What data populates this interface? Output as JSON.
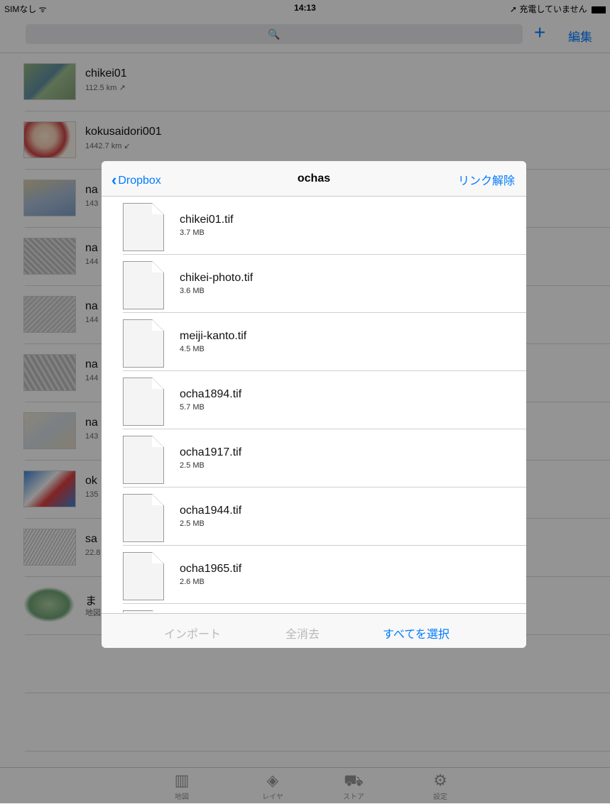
{
  "status_bar": {
    "carrier": "SIMなし ᯤ",
    "time": "14:13",
    "charging": "➚ 充電していません"
  },
  "top_bar": {
    "search_placeholder": "🔍",
    "add_label": "+",
    "edit_label": "編集"
  },
  "maps": [
    {
      "name": "chikei01",
      "sub": "112.5 km ↗"
    },
    {
      "name": "kokusaidori001",
      "sub": "1442.7 km ↙"
    },
    {
      "name": "na",
      "sub": "143"
    },
    {
      "name": "na",
      "sub": "144"
    },
    {
      "name": "na",
      "sub": "144"
    },
    {
      "name": "na",
      "sub": "144"
    },
    {
      "name": "na",
      "sub": "143"
    },
    {
      "name": "ok",
      "sub": "135"
    },
    {
      "name": "sa",
      "sub": "22.8"
    },
    {
      "name": "ま",
      "sub": "地図"
    }
  ],
  "modal": {
    "back_label": "Dropbox",
    "title": "ochas",
    "unlink_label": "リンク解除",
    "files": [
      {
        "name": "chikei01.tif",
        "size": "3.7 MB"
      },
      {
        "name": "chikei-photo.tif",
        "size": "3.6 MB"
      },
      {
        "name": "meiji-kanto.tif",
        "size": "4.5 MB"
      },
      {
        "name": "ocha1894.tif",
        "size": "5.7 MB"
      },
      {
        "name": "ocha1917.tif",
        "size": "2.5 MB"
      },
      {
        "name": "ocha1944.tif",
        "size": "2.5 MB"
      },
      {
        "name": "ocha1965.tif",
        "size": "2.6 MB"
      }
    ],
    "toolbar": {
      "import_label": "インポート",
      "clear_label": "全消去",
      "select_all_label": "すべてを選択"
    }
  },
  "tab_bar": {
    "tabs": [
      {
        "label": "地図",
        "icon": "map-icon"
      },
      {
        "label": "レイヤ",
        "icon": "layers-icon"
      },
      {
        "label": "ストア",
        "icon": "cart-icon"
      },
      {
        "label": "設定",
        "icon": "gear-icon"
      }
    ]
  },
  "colors": {
    "accent": "#007aff",
    "disabled": "#b8b8b8"
  }
}
